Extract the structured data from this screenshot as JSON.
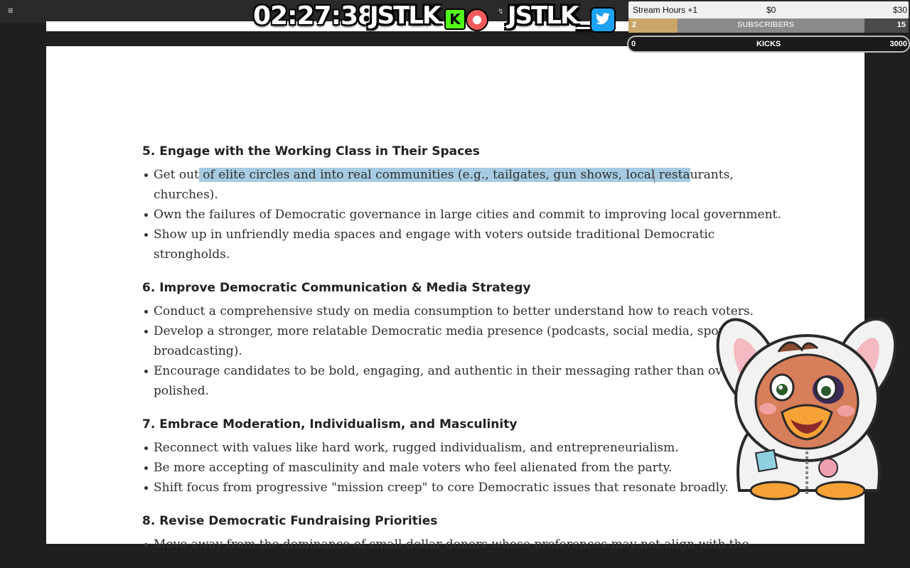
{
  "overlay": {
    "timer": "02:27:38",
    "brand_1": "JSTLK",
    "brand_2": "JSTLK_",
    "kick_letter": "K",
    "stream_hours": "Stream Hours +1",
    "money_start": "$0",
    "money_end": "$30",
    "subscribers": {
      "current": "2",
      "label": "SUBSCRIBERS",
      "goal": "15",
      "progress": 0.13
    },
    "kicks": {
      "current": "0",
      "label": "KICKS",
      "goal": "3000",
      "progress": 0
    },
    "colors": {
      "kick_green": "#53fc18",
      "twitter_blue": "#1da1f2",
      "selection": "#a6cbe2",
      "sub_fill": "#caa56a"
    }
  },
  "document": {
    "sections": [
      {
        "title": "5. Engage with the Working Class in Their Spaces",
        "items": [
          {
            "before": "Get out",
            "highlight": " of elite circles and into real communities (e.g., tailgates, gun shows, local resta",
            "after": "urants, churches)."
          },
          {
            "text": "Own the failures of Democratic governance in large cities and commit to improving local government."
          },
          {
            "text": "Show up in unfriendly media spaces and engage with voters outside traditional Democratic strongholds."
          }
        ]
      },
      {
        "title": "6. Improve Democratic Communication & Media Strategy",
        "items": [
          {
            "text": "Conduct a comprehensive study on media consumption to better understand how to reach voters."
          },
          {
            "text": "Develop a stronger, more relatable Democratic media presence (podcasts, social media, sports broadcasting)."
          },
          {
            "text": "Encourage candidates to be bold, engaging, and authentic in their messaging rather than overly polished."
          }
        ]
      },
      {
        "title": "7. Embrace Moderation, Individualism, and Masculinity",
        "items": [
          {
            "text": "Reconnect with values like hard work, rugged individualism, and entrepreneurialism."
          },
          {
            "text": "Be more accepting of masculinity and male voters who feel alienated from the party."
          },
          {
            "text": "Shift focus from progressive \"mission creep\" to core Democratic issues that resonate broadly."
          }
        ]
      },
      {
        "title": "8. Revise Democratic Fundraising Priorities",
        "items": [
          {
            "text": "Move away from the dominance of small-dollar donors whose preferences may not align with the"
          }
        ]
      }
    ]
  },
  "icons": {
    "menu": "hamburger-icon",
    "kick": "kick-logo-icon",
    "record": "record-icon",
    "twitter": "twitter-bird-icon",
    "mascot": "bunny-duck-mascot"
  }
}
